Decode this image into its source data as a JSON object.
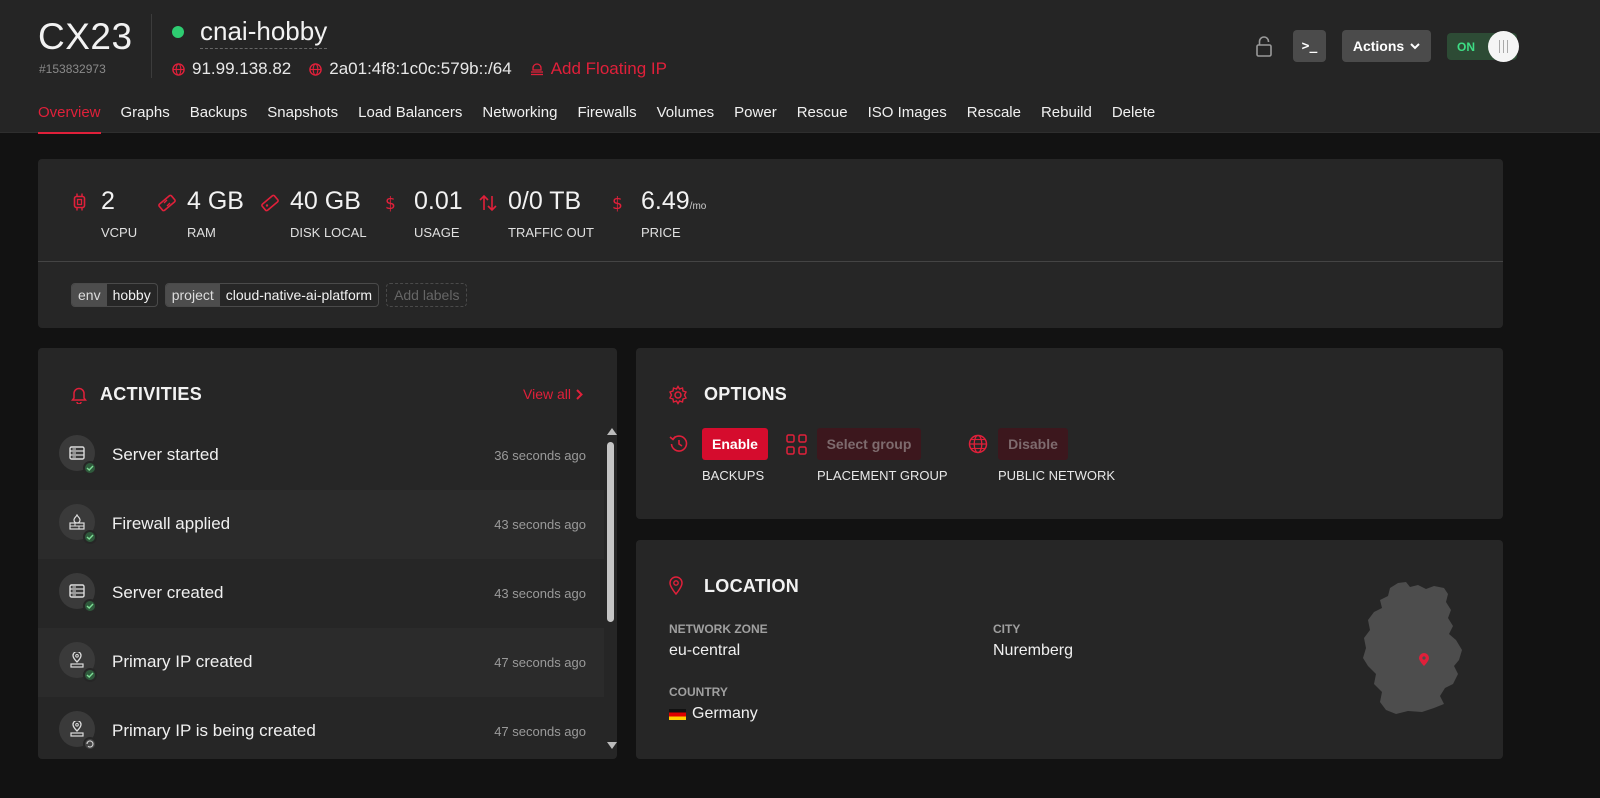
{
  "server": {
    "type": "CX23",
    "id": "#153832973",
    "name": "cnai-hobby",
    "ipv4": "91.99.138.82",
    "ipv6": "2a01:4f8:1c0c:579b::/64",
    "floating_ip": "Add Floating IP",
    "status_color": "#2ecc71"
  },
  "header": {
    "actions_label": "Actions",
    "console_label": ">_",
    "toggle_label": "ON"
  },
  "tabs": [
    "Overview",
    "Graphs",
    "Backups",
    "Snapshots",
    "Load Balancers",
    "Networking",
    "Firewalls",
    "Volumes",
    "Power",
    "Rescue",
    "ISO Images",
    "Rescale",
    "Rebuild",
    "Delete"
  ],
  "active_tab": "Overview",
  "specs": [
    {
      "value": "2",
      "unit": "",
      "label": "VCPU",
      "icon": "cpu-icon"
    },
    {
      "value": "4 GB",
      "unit": "",
      "label": "RAM",
      "icon": "ram-icon"
    },
    {
      "value": "40 GB",
      "unit": "",
      "label": "DISK LOCAL",
      "icon": "disk-icon"
    },
    {
      "value": "0.01",
      "unit": "",
      "label": "USAGE",
      "icon": "dollar-icon"
    },
    {
      "value": "0/0 TB",
      "unit": "",
      "label": "TRAFFIC OUT",
      "icon": "traffic-icon"
    },
    {
      "value": "6.49",
      "unit": "/mo",
      "label": "PRICE",
      "icon": "dollar-icon"
    }
  ],
  "labels": [
    {
      "key": "env",
      "value": "hobby"
    },
    {
      "key": "project",
      "value": "cloud-native-ai-platform"
    }
  ],
  "add_labels": "Add labels",
  "activities": {
    "title": "ACTIVITIES",
    "view_all": "View all",
    "items": [
      {
        "title": "Server started",
        "time": "36 seconds ago",
        "icon": "server-icon",
        "status": "done"
      },
      {
        "title": "Firewall applied",
        "time": "43 seconds ago",
        "icon": "firewall-icon",
        "status": "done"
      },
      {
        "title": "Server created",
        "time": "43 seconds ago",
        "icon": "server-icon",
        "status": "done"
      },
      {
        "title": "Primary IP created",
        "time": "47 seconds ago",
        "icon": "ip-icon",
        "status": "done"
      },
      {
        "title": "Primary IP is being created",
        "time": "47 seconds ago",
        "icon": "ip-icon",
        "status": "pending"
      }
    ]
  },
  "options": {
    "title": "OPTIONS",
    "backups": {
      "button": "Enable",
      "label": "BACKUPS"
    },
    "placement_group": {
      "button": "Select group",
      "label": "PLACEMENT GROUP"
    },
    "public_network": {
      "button": "Disable",
      "label": "PUBLIC NETWORK"
    }
  },
  "location": {
    "title": "LOCATION",
    "network_zone_label": "NETWORK ZONE",
    "network_zone": "eu-central",
    "city_label": "CITY",
    "city": "Nuremberg",
    "country_label": "COUNTRY",
    "country": "Germany"
  },
  "colors": {
    "accent": "#e0203a",
    "background": "#121212",
    "card": "#262626",
    "success": "#2ecc71"
  }
}
